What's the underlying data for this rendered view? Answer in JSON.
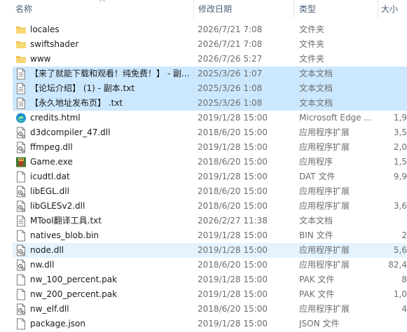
{
  "columns": {
    "name": "名称",
    "date": "修改日期",
    "type": "类型",
    "size": "大小"
  },
  "rows": [
    {
      "name": "locales",
      "date": "2026/7/21 7:08",
      "type": "文件夹",
      "size": "",
      "icon": "folder-icon",
      "state": ""
    },
    {
      "name": "swiftshader",
      "date": "2026/7/21 7:08",
      "type": "文件夹",
      "size": "",
      "icon": "folder-icon",
      "state": ""
    },
    {
      "name": "www",
      "date": "2026/7/26 5:27",
      "type": "文件夹",
      "size": "",
      "icon": "folder-icon",
      "state": ""
    },
    {
      "name": "【来了就能下载和观看！纯免费！】 - 副...",
      "date": "2025/3/26 1:07",
      "type": "文本文档",
      "size": "",
      "icon": "text-file-icon",
      "state": "selected"
    },
    {
      "name": "【论坛介绍】 (1) - 副本.txt",
      "date": "2025/3/26 1:08",
      "type": "文本文档",
      "size": "",
      "icon": "text-file-icon",
      "state": "selected"
    },
    {
      "name": "【永久地址发布页】 .txt",
      "date": "2025/3/26 1:08",
      "type": "文本文档",
      "size": "",
      "icon": "text-file-icon",
      "state": "selected"
    },
    {
      "name": "credits.html",
      "date": "2019/1/28 15:00",
      "type": "Microsoft Edge ...",
      "size": "1,9",
      "icon": "edge-html-icon",
      "state": ""
    },
    {
      "name": "d3dcompiler_47.dll",
      "date": "2018/6/20 15:00",
      "type": "应用程序扩展",
      "size": "3,5",
      "icon": "dll-file-icon",
      "state": ""
    },
    {
      "name": "ffmpeg.dll",
      "date": "2019/1/28 15:00",
      "type": "应用程序扩展",
      "size": "2,0",
      "icon": "dll-file-icon",
      "state": ""
    },
    {
      "name": "Game.exe",
      "date": "2018/6/20 15:00",
      "type": "应用程序",
      "size": "1,5",
      "icon": "game-exe-icon",
      "state": ""
    },
    {
      "name": "icudtl.dat",
      "date": "2019/1/28 15:00",
      "type": "DAT 文件",
      "size": "9,9",
      "icon": "blank-file-icon",
      "state": ""
    },
    {
      "name": "libEGL.dll",
      "date": "2018/6/20 15:00",
      "type": "应用程序扩展",
      "size": "",
      "icon": "dll-file-icon",
      "state": ""
    },
    {
      "name": "libGLESv2.dll",
      "date": "2018/6/20 15:00",
      "type": "应用程序扩展",
      "size": "3,6",
      "icon": "dll-file-icon",
      "state": ""
    },
    {
      "name": "MTool翻译工具.txt",
      "date": "2026/2/27 11:38",
      "type": "文本文档",
      "size": "",
      "icon": "text-file-icon",
      "state": ""
    },
    {
      "name": "natives_blob.bin",
      "date": "2019/1/28 15:00",
      "type": "BIN 文件",
      "size": "2",
      "icon": "blank-file-icon",
      "state": ""
    },
    {
      "name": "node.dll",
      "date": "2019/1/28 15:00",
      "type": "应用程序扩展",
      "size": "5,6",
      "icon": "dll-file-icon",
      "state": "hover"
    },
    {
      "name": "nw.dll",
      "date": "2018/6/20 15:00",
      "type": "应用程序扩展",
      "size": "82,4",
      "icon": "dll-file-icon",
      "state": ""
    },
    {
      "name": "nw_100_percent.pak",
      "date": "2019/1/28 15:00",
      "type": "PAK 文件",
      "size": "8",
      "icon": "blank-file-icon",
      "state": ""
    },
    {
      "name": "nw_200_percent.pak",
      "date": "2019/1/28 15:00",
      "type": "PAK 文件",
      "size": "1,0",
      "icon": "blank-file-icon",
      "state": ""
    },
    {
      "name": "nw_elf.dll",
      "date": "2018/6/20 15:00",
      "type": "应用程序扩展",
      "size": "4",
      "icon": "dll-file-icon",
      "state": ""
    },
    {
      "name": "package.json",
      "date": "2019/1/28 15:00",
      "type": "JSON 文件",
      "size": "",
      "icon": "blank-file-icon",
      "state": ""
    }
  ],
  "colors": {
    "selected_row": "#cce8ff",
    "hover_row": "#e5f3ff",
    "folder": "#f8d775",
    "header_text": "#4c607a"
  }
}
